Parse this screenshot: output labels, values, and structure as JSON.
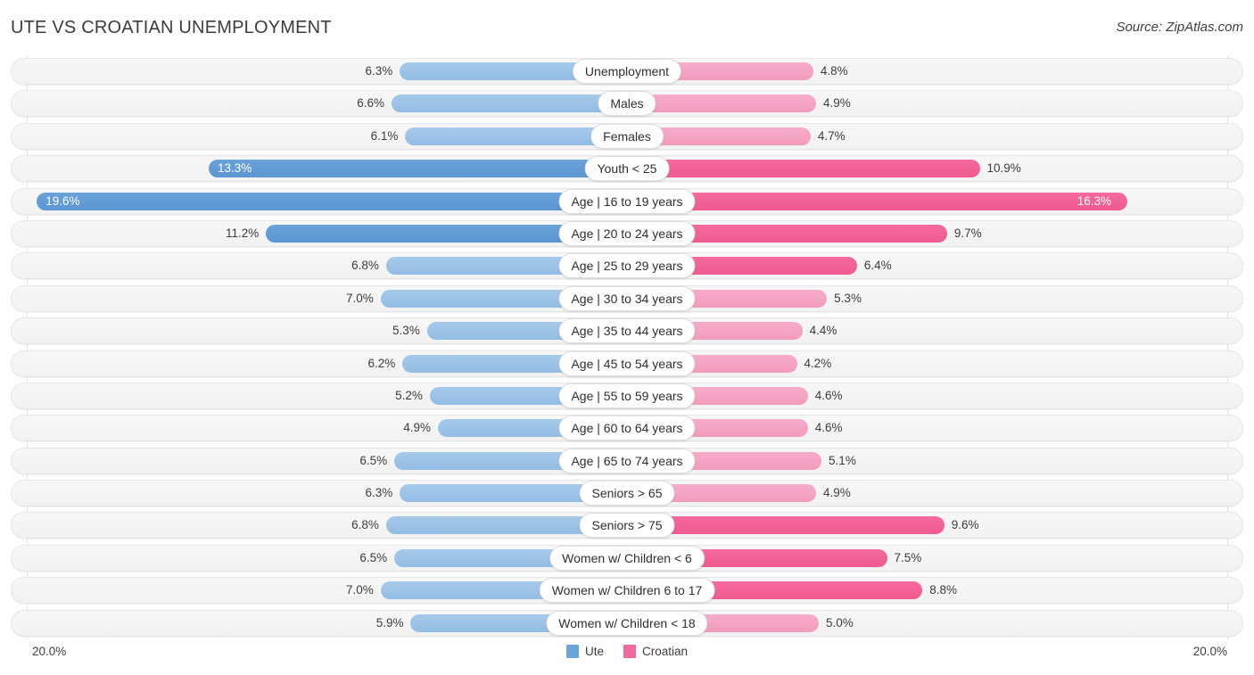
{
  "header": {
    "title": "UTE VS CROATIAN UNEMPLOYMENT",
    "source": "Source: ZipAtlas.com"
  },
  "axis": {
    "left_label": "20.0%",
    "right_label": "20.0%",
    "max": 20.0
  },
  "legend": {
    "items": [
      {
        "label": "Ute",
        "color": "#6ba3dc"
      },
      {
        "label": "Croatian",
        "color": "#f2699b"
      }
    ]
  },
  "colors": {
    "blue": "#9ac3e8",
    "blue_highlight": "#5b9bd5",
    "pink": "#f5a6c0",
    "pink_highlight": "#f26192",
    "track": "#f4f4f4",
    "gridline": "#e3e3e3"
  },
  "chart_data": {
    "type": "bar",
    "title": "UTE VS CROATIAN UNEMPLOYMENT",
    "subtitle": "Source: ZipAtlas.com",
    "orientation": "horizontal-diverging",
    "xlabel": "",
    "ylabel": "",
    "xlim": [
      20.0,
      20.0
    ],
    "grid": true,
    "legend_position": "bottom-center",
    "categories": [
      "Unemployment",
      "Males",
      "Females",
      "Youth < 25",
      "Age | 16 to 19 years",
      "Age | 20 to 24 years",
      "Age | 25 to 29 years",
      "Age | 30 to 34 years",
      "Age | 35 to 44 years",
      "Age | 45 to 54 years",
      "Age | 55 to 59 years",
      "Age | 60 to 64 years",
      "Age | 65 to 74 years",
      "Seniors > 65",
      "Seniors > 75",
      "Women w/ Children < 6",
      "Women w/ Children 6 to 17",
      "Women w/ Children < 18"
    ],
    "series": [
      {
        "name": "Ute",
        "color": "#9ac3e8",
        "values": [
          6.3,
          6.6,
          6.1,
          13.3,
          19.6,
          11.2,
          6.8,
          7.0,
          5.3,
          6.2,
          5.2,
          4.9,
          6.5,
          6.3,
          6.8,
          6.5,
          7.0,
          5.9
        ]
      },
      {
        "name": "Croatian",
        "color": "#f5a6c0",
        "values": [
          4.8,
          4.9,
          4.7,
          10.9,
          16.3,
          9.7,
          6.4,
          5.3,
          4.4,
          4.2,
          4.6,
          4.6,
          5.1,
          4.9,
          9.6,
          7.5,
          8.8,
          5.0
        ]
      }
    ]
  },
  "rows": [
    {
      "label": "Unemployment",
      "left": "6.3%",
      "right": "4.8%",
      "lv": 6.3,
      "rv": 4.8,
      "hl": false,
      "hr": false,
      "lin": false,
      "rin": false
    },
    {
      "label": "Males",
      "left": "6.6%",
      "right": "4.9%",
      "lv": 6.6,
      "rv": 4.9,
      "hl": false,
      "hr": false,
      "lin": false,
      "rin": false
    },
    {
      "label": "Females",
      "left": "6.1%",
      "right": "4.7%",
      "lv": 6.1,
      "rv": 4.7,
      "hl": false,
      "hr": false,
      "lin": false,
      "rin": false
    },
    {
      "label": "Youth < 25",
      "left": "13.3%",
      "right": "10.9%",
      "lv": 13.3,
      "rv": 10.9,
      "hl": true,
      "hr": true,
      "lin": true,
      "rin": false
    },
    {
      "label": "Age | 16 to 19 years",
      "left": "19.6%",
      "right": "16.3%",
      "lv": 19.6,
      "rv": 16.3,
      "hl": true,
      "hr": true,
      "lin": true,
      "rin": true
    },
    {
      "label": "Age | 20 to 24 years",
      "left": "11.2%",
      "right": "9.7%",
      "lv": 11.2,
      "rv": 9.7,
      "hl": true,
      "hr": true,
      "lin": false,
      "rin": false
    },
    {
      "label": "Age | 25 to 29 years",
      "left": "6.8%",
      "right": "6.4%",
      "lv": 6.8,
      "rv": 6.4,
      "hl": false,
      "hr": true,
      "lin": false,
      "rin": false
    },
    {
      "label": "Age | 30 to 34 years",
      "left": "7.0%",
      "right": "5.3%",
      "lv": 7.0,
      "rv": 5.3,
      "hl": false,
      "hr": false,
      "lin": false,
      "rin": false
    },
    {
      "label": "Age | 35 to 44 years",
      "left": "5.3%",
      "right": "4.4%",
      "lv": 5.3,
      "rv": 4.4,
      "hl": false,
      "hr": false,
      "lin": false,
      "rin": false
    },
    {
      "label": "Age | 45 to 54 years",
      "left": "6.2%",
      "right": "4.2%",
      "lv": 6.2,
      "rv": 4.2,
      "hl": false,
      "hr": false,
      "lin": false,
      "rin": false
    },
    {
      "label": "Age | 55 to 59 years",
      "left": "5.2%",
      "right": "4.6%",
      "lv": 5.2,
      "rv": 4.6,
      "hl": false,
      "hr": false,
      "lin": false,
      "rin": false
    },
    {
      "label": "Age | 60 to 64 years",
      "left": "4.9%",
      "right": "4.6%",
      "lv": 4.9,
      "rv": 4.6,
      "hl": false,
      "hr": false,
      "lin": false,
      "rin": false
    },
    {
      "label": "Age | 65 to 74 years",
      "left": "6.5%",
      "right": "5.1%",
      "lv": 6.5,
      "rv": 5.1,
      "hl": false,
      "hr": false,
      "lin": false,
      "rin": false
    },
    {
      "label": "Seniors > 65",
      "left": "6.3%",
      "right": "4.9%",
      "lv": 6.3,
      "rv": 4.9,
      "hl": false,
      "hr": false,
      "lin": false,
      "rin": false
    },
    {
      "label": "Seniors > 75",
      "left": "6.8%",
      "right": "9.6%",
      "lv": 6.8,
      "rv": 9.6,
      "hl": false,
      "hr": true,
      "lin": false,
      "rin": false
    },
    {
      "label": "Women w/ Children < 6",
      "left": "6.5%",
      "right": "7.5%",
      "lv": 6.5,
      "rv": 7.5,
      "hl": false,
      "hr": true,
      "lin": false,
      "rin": false
    },
    {
      "label": "Women w/ Children 6 to 17",
      "left": "7.0%",
      "right": "8.8%",
      "lv": 7.0,
      "rv": 8.8,
      "hl": false,
      "hr": true,
      "lin": false,
      "rin": false
    },
    {
      "label": "Women w/ Children < 18",
      "left": "5.9%",
      "right": "5.0%",
      "lv": 5.9,
      "rv": 5.0,
      "hl": false,
      "hr": false,
      "lin": false,
      "rin": false
    }
  ]
}
